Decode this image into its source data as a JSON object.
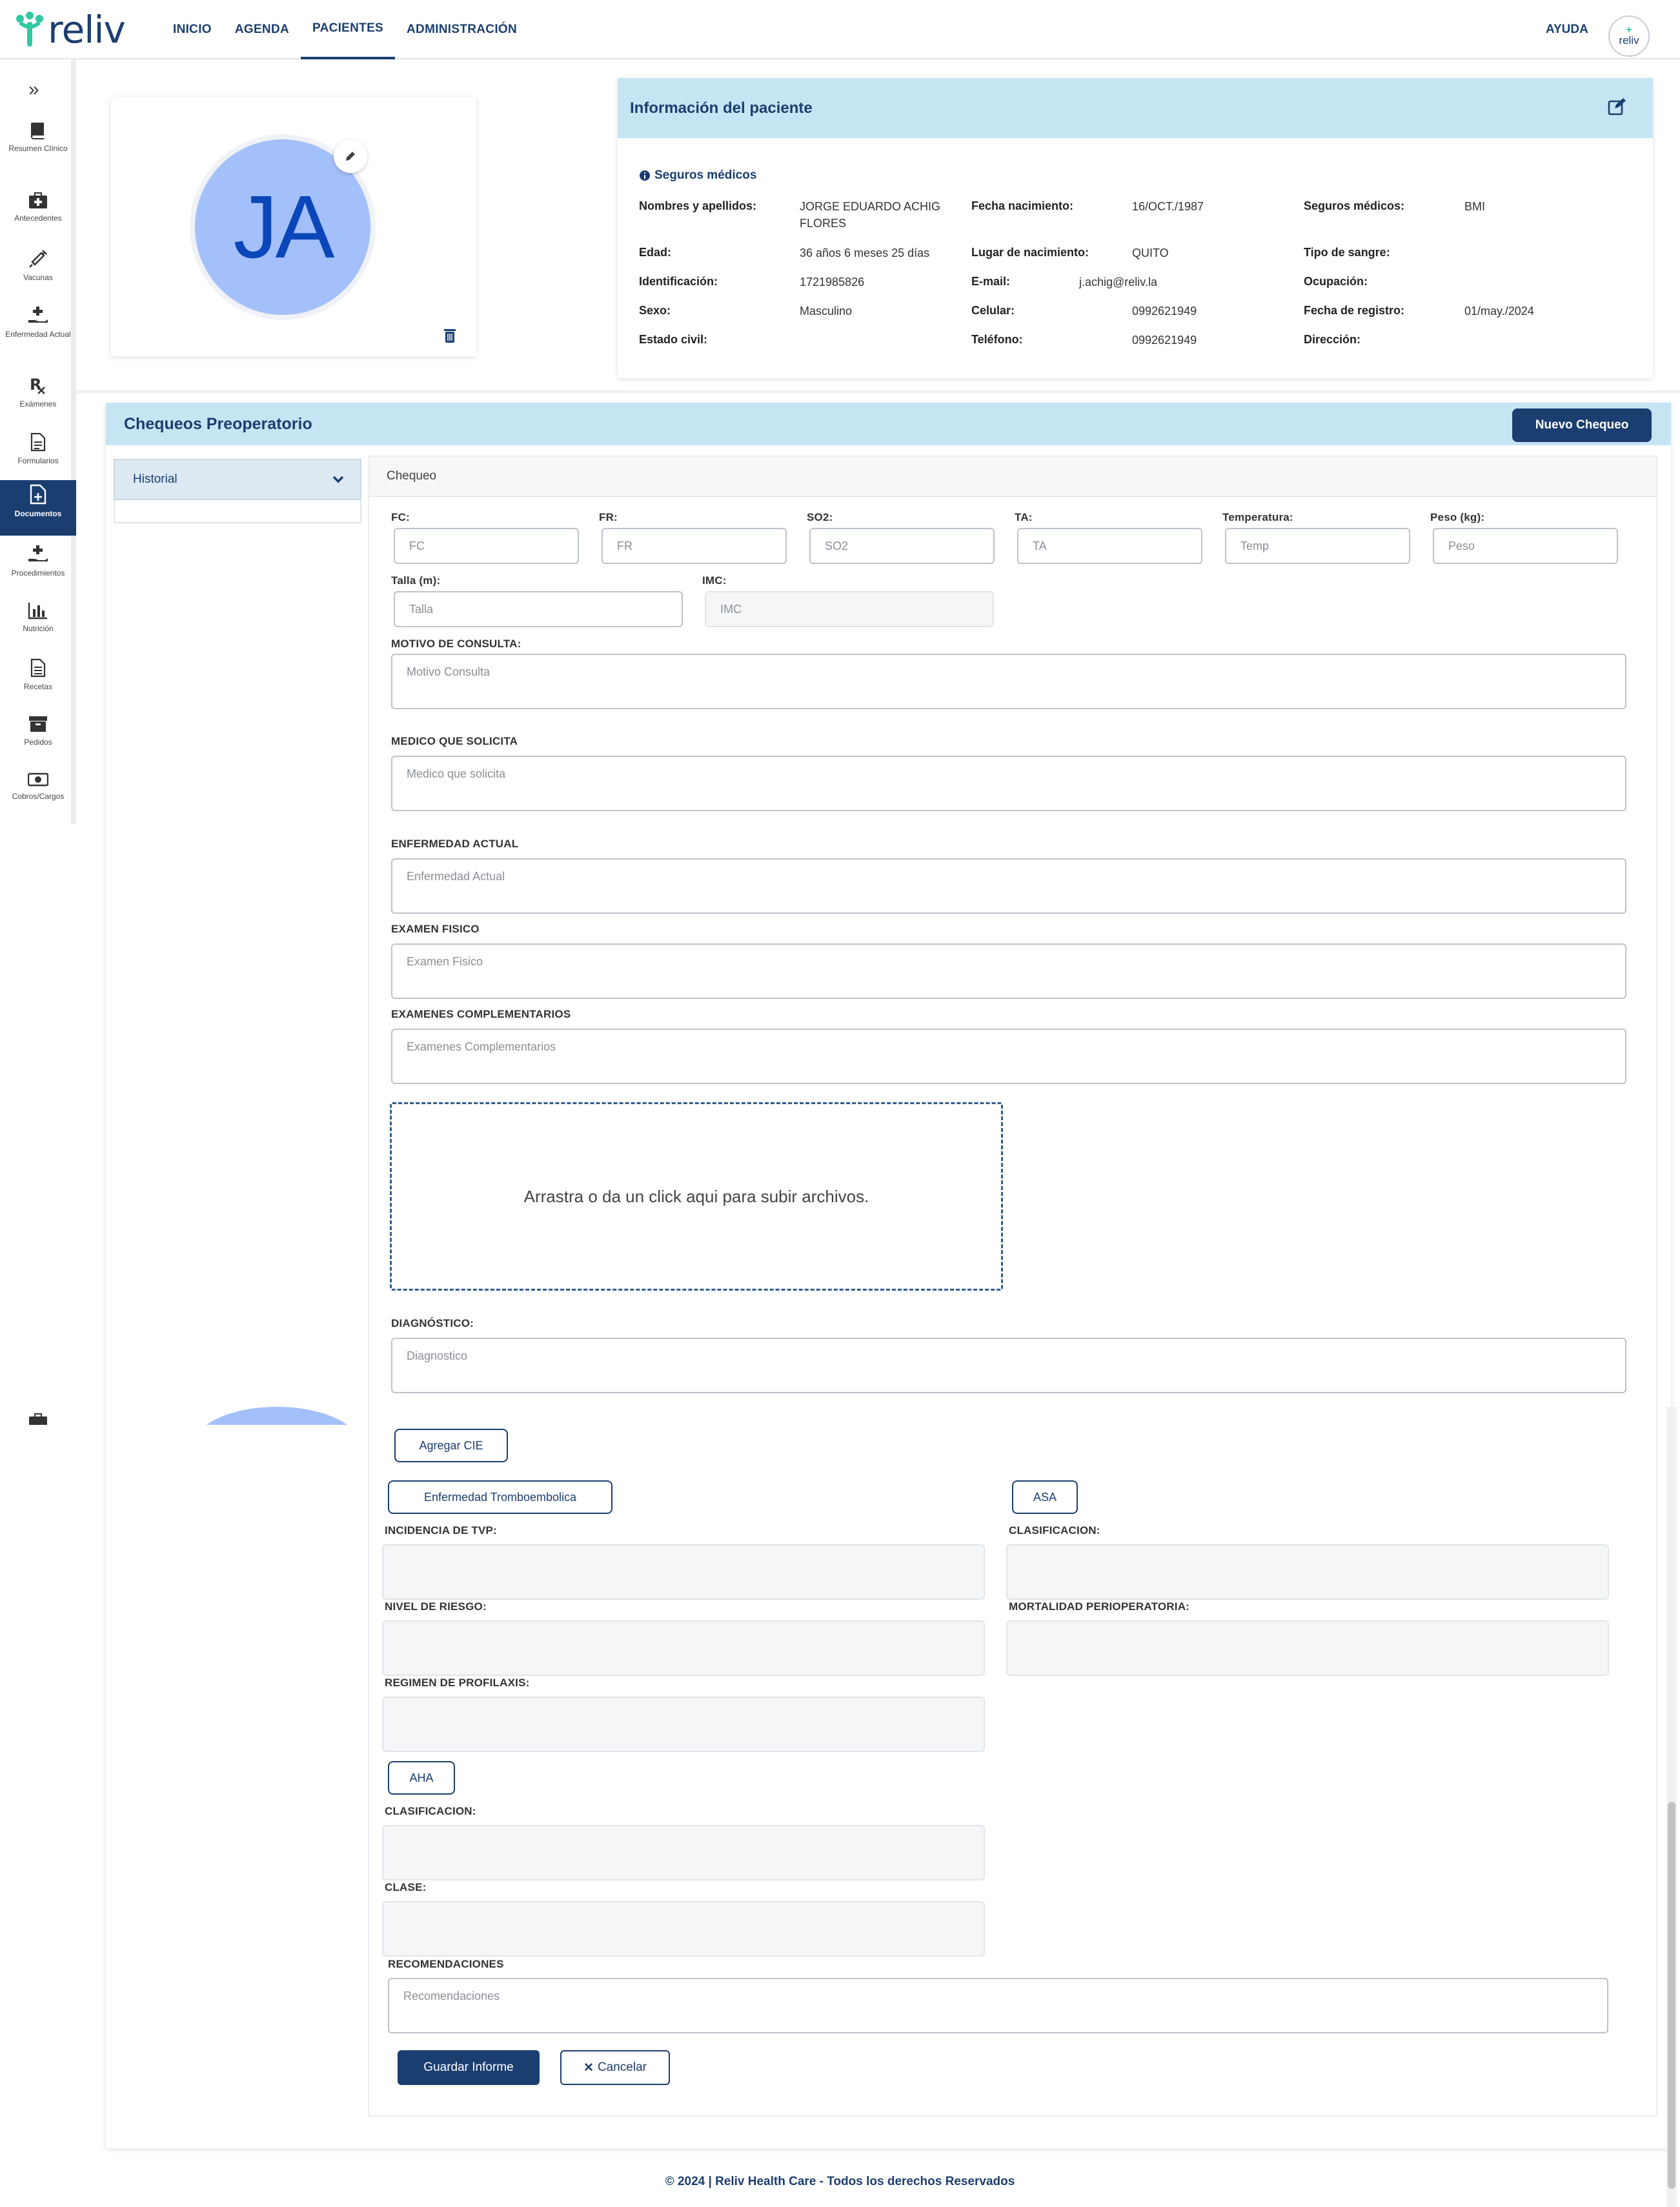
{
  "nav": {
    "logo_text": "reliv",
    "items": [
      "INICIO",
      "AGENDA",
      "PACIENTES",
      "ADMINISTRACIÓN"
    ],
    "active": "PACIENTES",
    "help": "AYUDA",
    "avatar_text": "reliv"
  },
  "sidebar": {
    "items": [
      {
        "label": "Resumen Clínico",
        "icon": "book-icon"
      },
      {
        "label": "Antecedentes",
        "icon": "medical-kit-icon"
      },
      {
        "label": "Vacunas",
        "icon": "syringe-icon"
      },
      {
        "label": "Enfermedad Actual",
        "icon": "hand-plus-icon"
      },
      {
        "label": "Exámenes",
        "icon": "rx-icon"
      },
      {
        "label": "Formularios",
        "icon": "file-icon"
      },
      {
        "label": "Documentos",
        "icon": "document-medical-icon"
      },
      {
        "label": "Procedimientos",
        "icon": "hand-plus-icon"
      },
      {
        "label": "Nutrición",
        "icon": "bar-chart-icon"
      },
      {
        "label": "Recetas",
        "icon": "file-lines-icon"
      },
      {
        "label": "Pedidos",
        "icon": "archive-icon"
      },
      {
        "label": "Cobros/Cargos",
        "icon": "money-icon"
      }
    ],
    "active": "Documentos"
  },
  "profile": {
    "initials": "JA"
  },
  "patient": {
    "title": "Información del paciente",
    "insurance_title": "Seguros médicos",
    "fields": {
      "nombres_label": "Nombres y apellidos:",
      "nombres": "JORGE EDUARDO ACHIG FLORES",
      "edad_label": "Edad:",
      "edad": "36 años 6 meses 25 días",
      "ident_label": "Identificación:",
      "ident": "1721985826",
      "sexo_label": "Sexo:",
      "sexo": "Masculino",
      "civil_label": "Estado civil:",
      "fnac_label": "Fecha nacimiento:",
      "fnac": "16/OCT./1987",
      "lnac_label": "Lugar de nacimiento:",
      "lnac": "QUITO",
      "email_label": "E-mail:",
      "email": "j.achig@reliv.la",
      "celular_label": "Celular:",
      "celular": "0992621949",
      "telefono_label": "Teléfono:",
      "telefono": "0992621949",
      "seguros_label": "Seguros médicos:",
      "seguros": "BMI",
      "sangre_label": "Tipo de sangre:",
      "ocupacion_label": "Ocupación:",
      "registro_label": "Fecha de registro:",
      "registro": "01/may./2024",
      "direccion_label": "Dirección:"
    }
  },
  "checks": {
    "title": "Chequeos Preoperatorio",
    "new_button": "Nuevo Chequeo",
    "history": "Historial",
    "tab": "Chequeo"
  },
  "form": {
    "fc_label": "FC:",
    "fc_ph": "FC",
    "fr_label": "FR:",
    "fr_ph": "FR",
    "so2_label": "SO2:",
    "so2_ph": "SO2",
    "ta_label": "TA:",
    "ta_ph": "TA",
    "temp_label": "Temperatura:",
    "temp_ph": "Temp",
    "peso_label": "Peso (kg):",
    "peso_ph": "Peso",
    "talla_label": "Talla (m):",
    "talla_ph": "Talla",
    "imc_label": "IMC:",
    "imc_ph": "IMC",
    "motivo_label": "MOTIVO DE CONSULTA:",
    "motivo_ph": "Motivo Consulta",
    "medico_label": "MEDICO QUE SOLICITA",
    "medico_ph": "Medico que solicita",
    "enfermedad_label": "ENFERMEDAD ACTUAL",
    "enfermedad_ph": "Enfermedad Actual",
    "examen_label": "EXAMEN FISICO",
    "examen_ph": "Examen Fisico",
    "complementarios_label": "EXAMENES COMPLEMENTARIOS",
    "complementarios_ph": "Examenes Complementarios",
    "dropzone": "Arrastra o da un click aqui para subir archivos.",
    "diagnostico_label": "DIAGNÓSTICO:",
    "diagnostico_ph": "Diagnostico",
    "agregar_cie": "Agregar CIE",
    "trombo_button": "Enfermedad Tromboembolica",
    "asa_button": "ASA",
    "tvp_label": "INCIDENCIA DE TVP:",
    "clasif_label": "CLASIFICACION:",
    "riesgo_label": "NIVEL DE RIESGO:",
    "mortalidad_label": "MORTALIDAD PERIOPERATORIA:",
    "profilaxis_label": "REGIMEN DE PROFILAXIS:",
    "aha_button": "AHA",
    "clasif2_label": "CLASIFICACION:",
    "clase_label": "CLASE:",
    "recomendaciones_label": "RECOMENDACIONES",
    "recomendaciones_ph": "Recomendaciones",
    "save": "Guardar Informe",
    "cancel": "Cancelar"
  },
  "footer": "© 2024 | Reliv Health Care - Todos los derechos Reservados"
}
